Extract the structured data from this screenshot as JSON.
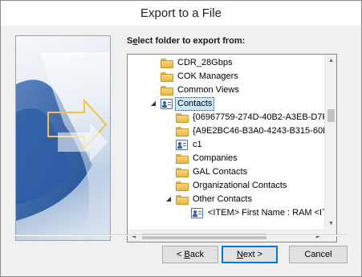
{
  "window": {
    "title": "Export to a File"
  },
  "prompt": {
    "before": "S",
    "mnemonic": "e",
    "after": "lect folder to export from:"
  },
  "tree": {
    "rows": [
      {
        "label": "CDR_28Gbps",
        "icon": "folder-icon",
        "expander": ""
      },
      {
        "label": "COK Managers",
        "icon": "folder-icon",
        "expander": ""
      },
      {
        "label": "Common Views",
        "icon": "folder-icon",
        "expander": ""
      },
      {
        "label": "Contacts",
        "icon": "contacts-icon",
        "expander": "◢",
        "selected": true
      },
      {
        "label": "{06967759-274D-40B2-A3EB-D7F",
        "icon": "folder-icon",
        "expander": ""
      },
      {
        "label": "{A9E2BC46-B3A0-4243-B315-60D",
        "icon": "folder-icon",
        "expander": ""
      },
      {
        "label": "c1",
        "icon": "contacts-icon",
        "expander": ""
      },
      {
        "label": "Companies",
        "icon": "folder-icon",
        "expander": ""
      },
      {
        "label": "GAL Contacts",
        "icon": "folder-icon",
        "expander": ""
      },
      {
        "label": "Organizational Contacts",
        "icon": "folder-icon",
        "expander": ""
      },
      {
        "label": "Other Contacts",
        "icon": "folder-icon",
        "expander": "◢"
      },
      {
        "label": "<ITEM> First Name : RAM <IT",
        "icon": "contacts-icon",
        "expander": ""
      }
    ]
  },
  "buttons": {
    "back": {
      "prefix": "< ",
      "mnemonic": "B",
      "rest": "ack"
    },
    "next": {
      "mnemonic": "N",
      "rest": "ext >"
    },
    "cancel": {
      "label": "Cancel"
    }
  },
  "colors": {
    "accent": "#0078d7",
    "selection": "#cce8ff",
    "folder": "#e8b847",
    "contact_icon": "#2f5fa8"
  }
}
